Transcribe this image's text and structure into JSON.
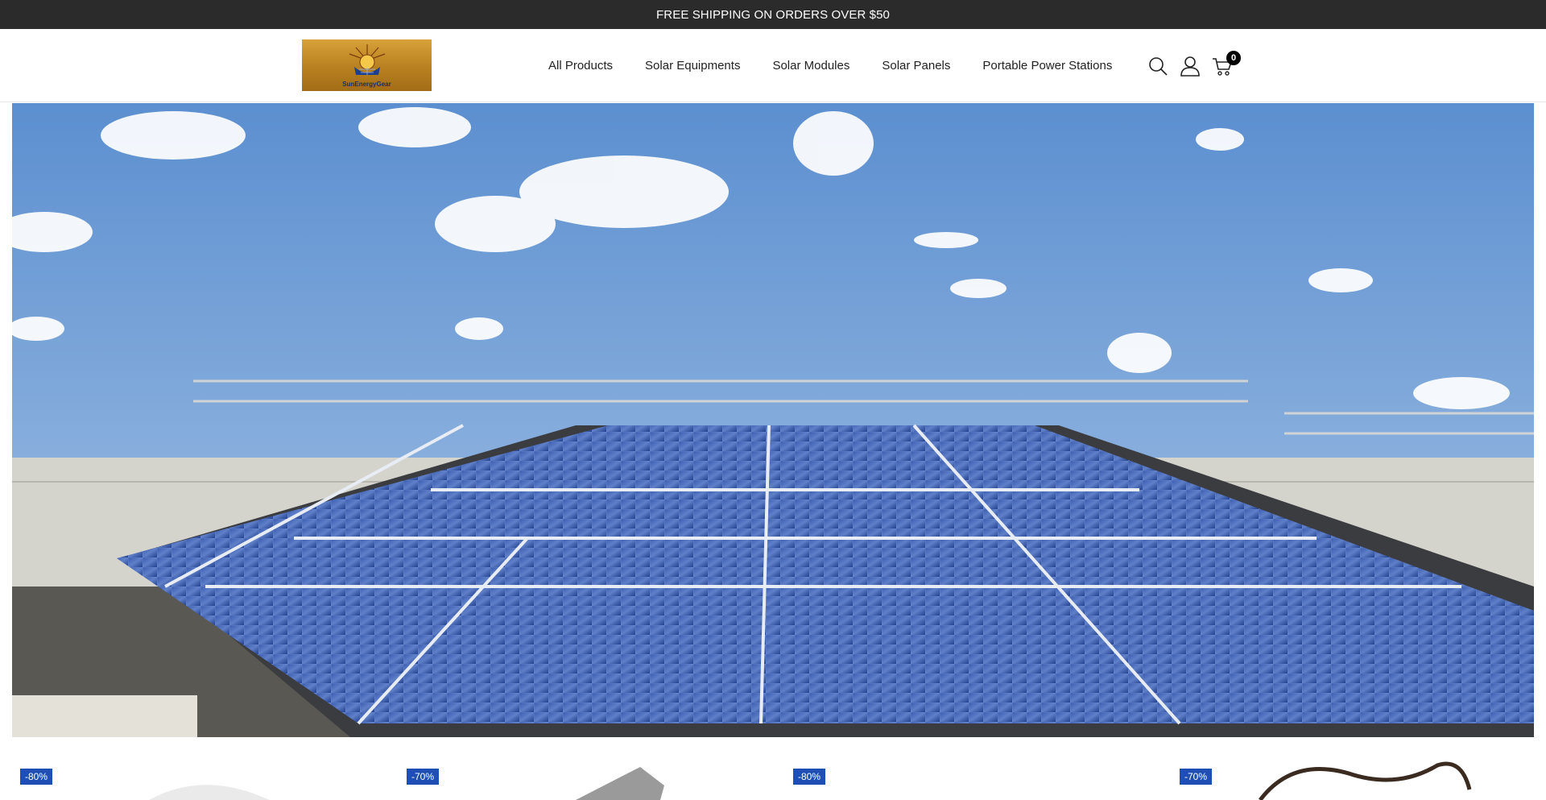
{
  "announcement": "FREE SHIPPING ON ORDERS OVER $50",
  "logo": {
    "text": "SunEnergyGear"
  },
  "nav": {
    "items": [
      "All Products",
      "Solar Equipments",
      "Solar Modules",
      "Solar Panels",
      "Portable Power Stations"
    ]
  },
  "header_icons": {
    "search": "search-icon",
    "account": "user-icon",
    "cart": "cart-icon",
    "cart_count": "0"
  },
  "hero": {
    "image": "rooftop solar panel array under blue sky"
  },
  "products": [
    {
      "badge": "-80%"
    },
    {
      "badge": "-70%"
    },
    {
      "badge": "-80%"
    },
    {
      "badge": "-70%"
    }
  ],
  "colors": {
    "announcement_bg": "#2b2b2b",
    "badge_bg": "#1f4fb4",
    "sky": "#6b9ad1",
    "panel": "#2a4a9a"
  }
}
